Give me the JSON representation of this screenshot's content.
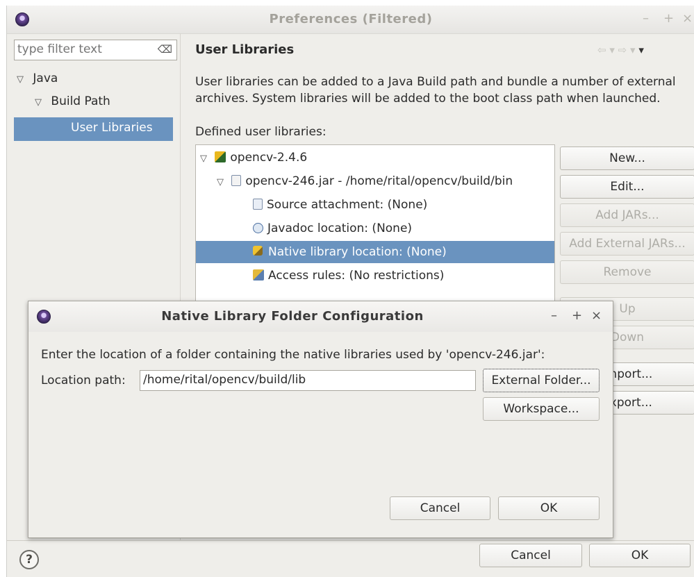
{
  "window": {
    "title": "Preferences (Filtered)",
    "wm": {
      "minimize": "–",
      "maximize": "+",
      "close": "×"
    }
  },
  "filter": {
    "placeholder": "type filter text"
  },
  "tree": {
    "java": "Java",
    "build_path": "Build Path",
    "user_libraries": "User Libraries"
  },
  "section": {
    "title": "User Libraries",
    "nav": "⇦ ▾ ⇨ ▾ ▾"
  },
  "description": "User libraries can be added to a Java Build path and bundle a number of external archives. System libraries will be added to the boot class path when launched.",
  "defined_label": "Defined user libraries:",
  "library": {
    "name": "opencv-2.4.6",
    "jar": "opencv-246.jar - /home/rital/opencv/build/bin",
    "source": "Source attachment: (None)",
    "javadoc": "Javadoc location: (None)",
    "native": "Native library location: (None)",
    "access": "Access rules: (No restrictions)"
  },
  "side_buttons": {
    "new": "New...",
    "edit": "Edit...",
    "add_jars": "Add JARs...",
    "add_external_jars": "Add External JARs...",
    "remove": "Remove",
    "up": "Up",
    "down": "Down",
    "import": "Import...",
    "export": "Export..."
  },
  "dialog": {
    "title": "Native Library Folder Configuration",
    "wm": {
      "minimize": "–",
      "maximize": "+",
      "close": "×"
    },
    "prompt": "Enter the location of a folder containing the native libraries used by 'opencv-246.jar':",
    "location_label": "Location path:",
    "location_value": "/home/rital/opencv/build/lib",
    "external_folder": "External Folder...",
    "workspace": "Workspace...",
    "cancel": "Cancel",
    "ok": "OK"
  },
  "footer": {
    "help": "?",
    "cancel": "Cancel",
    "ok": "OK"
  },
  "colors": {
    "selection": "#6a93bf",
    "window_bg": "#efeeea",
    "logo": "#6d4c9a"
  }
}
